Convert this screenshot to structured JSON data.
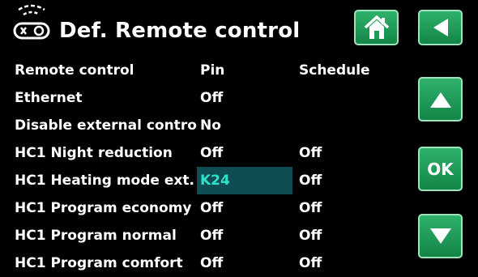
{
  "header": {
    "title": "Def. Remote control",
    "icon": "remote-control-icon"
  },
  "table": {
    "headers": {
      "col1": "Remote control",
      "col2": "Pin",
      "col3": "Schedule"
    },
    "rows": [
      {
        "name": "Ethernet",
        "pin": "Off",
        "schedule": ""
      },
      {
        "name": "Disable external control",
        "pin": "No",
        "schedule": ""
      },
      {
        "name": "HC1 Night reduction",
        "pin": "Off",
        "schedule": "Off"
      },
      {
        "name": "HC1 Heating mode ext.",
        "pin": "K24",
        "schedule": "Off"
      },
      {
        "name": "HC1 Program economy",
        "pin": "Off",
        "schedule": "Off"
      },
      {
        "name": "HC1 Program normal",
        "pin": "Off",
        "schedule": "Off"
      },
      {
        "name": "HC1 Program comfort",
        "pin": "Off",
        "schedule": "Off"
      }
    ],
    "selected_row": 3
  },
  "buttons": {
    "home": "home-icon",
    "back": "back-arrow-icon",
    "up": "up-arrow-icon",
    "ok_label": "OK",
    "down": "down-arrow-icon"
  },
  "colors": {
    "background": "#000000",
    "button_green": "#1f9c58",
    "selection_bg": "#0f4d52",
    "selection_text": "#2be3c8"
  }
}
